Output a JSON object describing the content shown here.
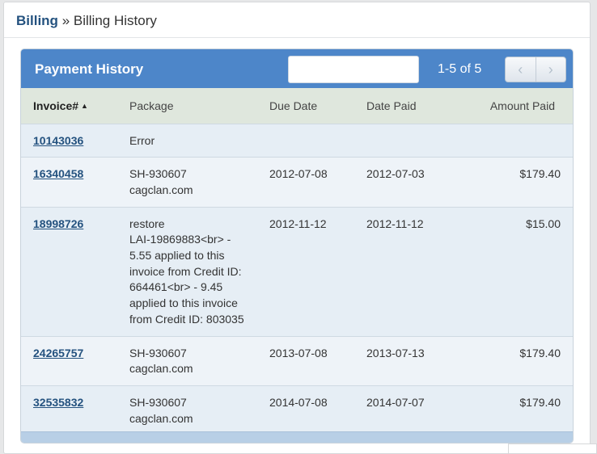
{
  "breadcrumb": {
    "parent": "Billing",
    "separator": "»",
    "current": "Billing History"
  },
  "panel": {
    "title": "Payment History",
    "search_placeholder": "",
    "pager_text": "1-5 of 5",
    "prev_icon": "chevron-left-icon",
    "next_icon": "chevron-right-icon"
  },
  "table": {
    "columns": [
      "Invoice#",
      "Package",
      "Due Date",
      "Date Paid",
      "Amount Paid"
    ],
    "sort_indicator": "▲",
    "rows": [
      {
        "invoice": "10143036",
        "package": "Error",
        "due": "",
        "paid": "",
        "amount": ""
      },
      {
        "invoice": "16340458",
        "package": "SH-930607\ncagclan.com",
        "due": "2012-07-08",
        "paid": "2012-07-03",
        "amount": "$179.40"
      },
      {
        "invoice": "18998726",
        "package": "restore\nLAI-19869883<br> -\n5.55 applied to this\ninvoice from Credit ID:\n664461<br> - 9.45\napplied to this invoice\nfrom Credit ID: 803035",
        "due": "2012-11-12",
        "paid": "2012-11-12",
        "amount": "$15.00"
      },
      {
        "invoice": "24265757",
        "package": "SH-930607\ncagclan.com",
        "due": "2013-07-08",
        "paid": "2013-07-13",
        "amount": "$179.40"
      },
      {
        "invoice": "32535832",
        "package": "SH-930607\ncagclan.com",
        "due": "2014-07-08",
        "paid": "2014-07-07",
        "amount": "$179.40"
      }
    ]
  },
  "colors": {
    "header_blue": "#4d86c9",
    "link": "#24527f",
    "thead_bg": "#dfe7dd"
  }
}
